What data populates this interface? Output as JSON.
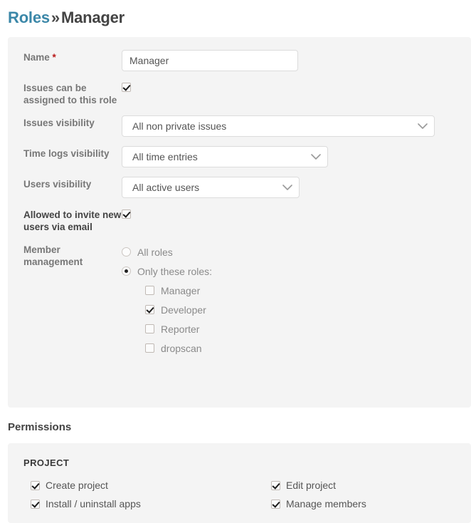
{
  "header": {
    "breadcrumb_link": "Roles",
    "breadcrumb_separator": "»",
    "breadcrumb_current": "Manager"
  },
  "form": {
    "name": {
      "label": "Name",
      "required_marker": "*",
      "value": "Manager",
      "placeholder": "Name"
    },
    "assignable": {
      "label": "Issues can be assigned to this role",
      "checked": "true"
    },
    "issues_visibility": {
      "label": "Issues visibility",
      "value": "All non private issues"
    },
    "time_logs_visibility": {
      "label": "Time logs visibility",
      "value": "All time entries"
    },
    "users_visibility": {
      "label": "Users visibility",
      "value": "All active users"
    },
    "invite_users": {
      "label": "Allowed to invite new users via email",
      "checked": "true"
    },
    "member_management": {
      "label": "Member management",
      "option_all": "All roles",
      "option_only": "Only these roles:",
      "roles": [
        {
          "label": "Manager",
          "checked": "false"
        },
        {
          "label": "Developer",
          "checked": "true"
        },
        {
          "label": "Reporter",
          "checked": "false"
        },
        {
          "label": "dropscan",
          "checked": "false"
        }
      ]
    }
  },
  "permissions": {
    "heading": "Permissions",
    "group_title": "PROJECT",
    "items": [
      {
        "label": "Create project",
        "checked": "true"
      },
      {
        "label": "Edit project",
        "checked": "true"
      },
      {
        "label": "Install / uninstall apps",
        "checked": "true"
      },
      {
        "label": "Manage members",
        "checked": "true"
      }
    ]
  },
  "colors": {
    "link": "#3b87a8",
    "panel_bg": "#f4f4f4",
    "required": "#b81818",
    "label": "#777777"
  }
}
